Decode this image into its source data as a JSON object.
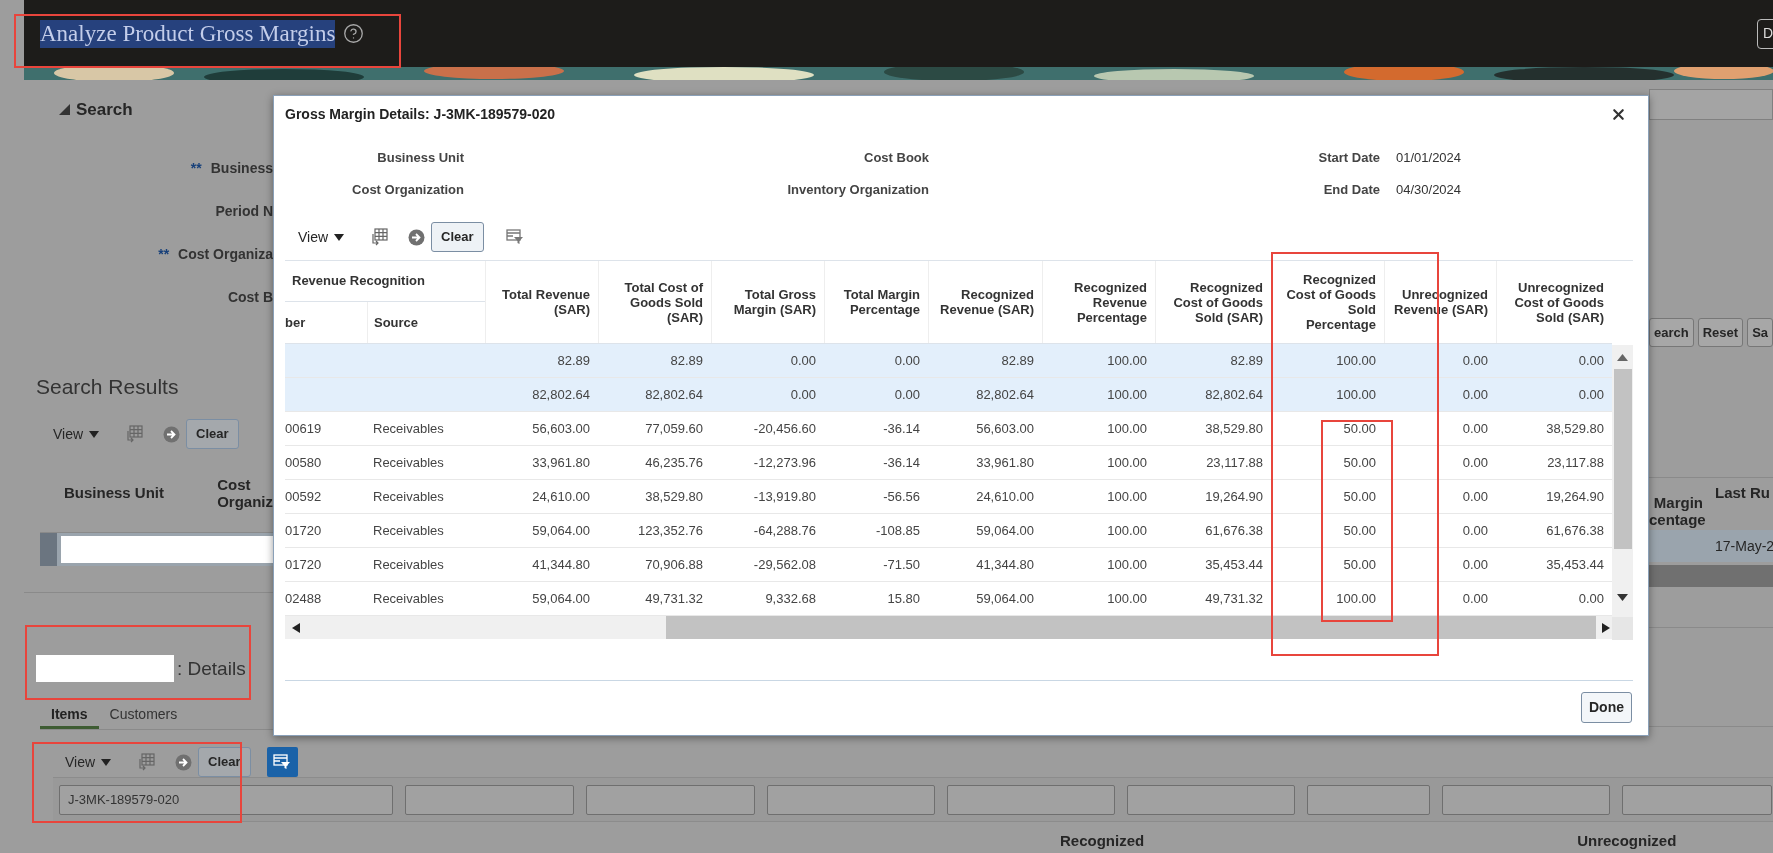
{
  "header": {
    "title": "Analyze Product Gross Margins",
    "title_selected": true,
    "button": "D"
  },
  "search": {
    "heading": "Search",
    "expanded": true,
    "fields": [
      {
        "marker": "**",
        "label": "Business"
      },
      {
        "label": "Period N"
      },
      {
        "marker": "**",
        "label": "Cost Organiza"
      },
      {
        "label": "Cost B"
      }
    ],
    "buttons": [
      "earch",
      "Reset",
      "Sa"
    ]
  },
  "search_results": {
    "heading": "Search Results",
    "toolbar": {
      "view": "View",
      "clear": "Clear"
    },
    "columns_left": [
      {
        "lines": [
          "Business Unit"
        ]
      },
      {
        "lines": [
          "Cost",
          "Organiz"
        ]
      }
    ],
    "columns_right": [
      {
        "lines": [
          "Margin",
          "centage"
        ]
      },
      {
        "lines": [
          "Last Ru"
        ]
      }
    ],
    "rows": [
      {
        "selected": true,
        "last_run": "17-May-2"
      }
    ]
  },
  "details": {
    "title": ": Details",
    "tabs": [
      {
        "label": "Items",
        "selected": true
      },
      {
        "label": "Customers",
        "selected": false
      }
    ],
    "toolbar": {
      "view": "View",
      "clear": "Clear",
      "filter_on": true
    },
    "filters": [
      {
        "kind": "text",
        "value": "J-3MK-189579-020"
      },
      {
        "kind": "empty"
      },
      {
        "kind": "empty"
      },
      {
        "kind": "empty"
      },
      {
        "kind": "empty"
      },
      {
        "kind": "empty"
      },
      {
        "kind": "empty"
      },
      {
        "kind": "empty"
      },
      {
        "kind": "empty"
      }
    ],
    "column_groups": [
      "Recognized",
      "Unrecognized"
    ]
  },
  "dialog": {
    "title": "Gross Margin Details: J-3MK-189579-020",
    "fields": [
      {
        "label": "Business Unit"
      },
      {
        "label": "Cost Book"
      },
      {
        "label": "Start Date",
        "value": "01/01/2024"
      },
      {
        "label": "Cost Organization"
      },
      {
        "label": "Inventory Organization"
      },
      {
        "label": "End Date",
        "value": "04/30/2024"
      }
    ],
    "toolbar": {
      "view": "View",
      "clear": "Clear",
      "filter_on": false
    },
    "group_header": "Revenue Recognition",
    "group_columns": [
      "ber",
      "Source"
    ],
    "columns": [
      "Total Revenue (SAR)",
      "Total Cost of Goods Sold (SAR)",
      "Total Gross Margin (SAR)",
      "Total Margin Percentage",
      "Recognized Revenue (SAR)",
      "Recognized Revenue Percentage",
      "Recognized Cost of Goods Sold (SAR)",
      "Recognized Cost of Goods Sold Percentage",
      "Unrecognized Revenue (SAR)",
      "Unrecognized Cost of Goods Sold (SAR)"
    ],
    "rows": [
      {
        "selected": true,
        "values": [
          "82.89",
          "82.89",
          "0.00",
          "0.00",
          "82.89",
          "100.00",
          "82.89",
          "100.00",
          "0.00",
          "0.00"
        ]
      },
      {
        "selected": true,
        "values": [
          "82,802.64",
          "82,802.64",
          "0.00",
          "0.00",
          "82,802.64",
          "100.00",
          "82,802.64",
          "100.00",
          "0.00",
          "0.00"
        ]
      },
      {
        "selected": false,
        "number": "00619",
        "source": "Receivables",
        "values": [
          "56,603.00",
          "77,059.60",
          "-20,456.60",
          "-36.14",
          "56,603.00",
          "100.00",
          "38,529.80",
          "50.00",
          "0.00",
          "38,529.80"
        ]
      },
      {
        "selected": false,
        "number": "00580",
        "source": "Receivables",
        "values": [
          "33,961.80",
          "46,235.76",
          "-12,273.96",
          "-36.14",
          "33,961.80",
          "100.00",
          "23,117.88",
          "50.00",
          "0.00",
          "23,117.88"
        ]
      },
      {
        "selected": false,
        "number": "00592",
        "source": "Receivables",
        "values": [
          "24,610.00",
          "38,529.80",
          "-13,919.80",
          "-56.56",
          "24,610.00",
          "100.00",
          "19,264.90",
          "50.00",
          "0.00",
          "19,264.90"
        ]
      },
      {
        "selected": false,
        "number": "01720",
        "source": "Receivables",
        "values": [
          "59,064.00",
          "123,352.76",
          "-64,288.76",
          "-108.85",
          "59,064.00",
          "100.00",
          "61,676.38",
          "50.00",
          "0.00",
          "61,676.38"
        ]
      },
      {
        "selected": false,
        "number": "01720",
        "source": "Receivables",
        "values": [
          "41,344.80",
          "70,906.88",
          "-29,562.08",
          "-71.50",
          "41,344.80",
          "100.00",
          "35,453.44",
          "50.00",
          "0.00",
          "35,453.44"
        ]
      },
      {
        "selected": false,
        "number": "02488",
        "source": "Receivables",
        "values": [
          "59,064.00",
          "49,731.32",
          "9,332.68",
          "15.80",
          "59,064.00",
          "100.00",
          "49,731.32",
          "100.00",
          "0.00",
          "0.00"
        ]
      }
    ],
    "done": "Done"
  }
}
